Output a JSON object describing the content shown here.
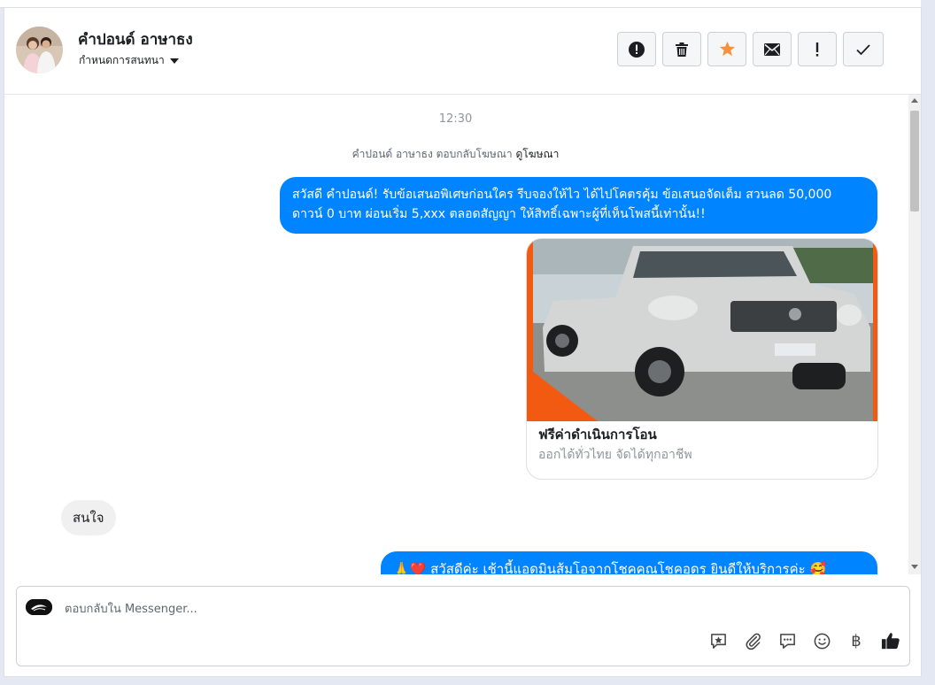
{
  "header": {
    "contact_name": "คำปอนด์ อาษาธง",
    "assign_label": "กำหนดการสนทนา",
    "actions": [
      {
        "name": "spam-button",
        "icon": "alert-circle-icon"
      },
      {
        "name": "delete-button",
        "icon": "trash-icon"
      },
      {
        "name": "star-button",
        "icon": "star-icon"
      },
      {
        "name": "mark-unread-button",
        "icon": "envelope-icon"
      },
      {
        "name": "follow-up-button",
        "icon": "exclamation-icon"
      },
      {
        "name": "mark-done-button",
        "icon": "checkmark-icon"
      }
    ]
  },
  "thread": {
    "time": "12:30",
    "reply_note": "คำปอนด์ อาษาธง ตอบกลับโฆษณา",
    "reply_note_link": "ดูโฆษณา",
    "ad_message": "สวัสดี คำปอนด์! รับข้อเสนอพิเศษก่อนใคร รีบจองให้ไว ได้ไปโคตรคุ้ม ข้อเสนอจัดเต็ม สวนลด 50,000 ดาวน์ 0 บาท ผ่อนเริ่ม 5,xxx ตลอดสัญญา ให้สิทธิ์เฉพาะผู้ที่เห็นโพสนี้เท่านั้น!!",
    "card": {
      "title": "ฟรีค่าดำเนินการโอน",
      "subtitle": "ออกได้ทั่วไทย จัดได้ทุกอาชีพ"
    },
    "incoming_message": "สนใจ",
    "outgoing_message": "🙏❤️ สวัสดีค่ะ เช้านี้แอดมินส้มโอจากโชคคูณโชคอุดร ยินดีให้บริการค่ะ 🥰"
  },
  "composer": {
    "placeholder": "ตอบกลับใน Messenger...",
    "tools": [
      "saved-reply-icon",
      "attachment-icon",
      "message-bubble-icon",
      "emoji-icon",
      "baht-icon",
      "thumbs-up-icon"
    ],
    "baht_symbol": "฿"
  },
  "colors": {
    "accent": "#0084ff",
    "star": "#f7923b",
    "card_border_orange": "#f35a11"
  }
}
